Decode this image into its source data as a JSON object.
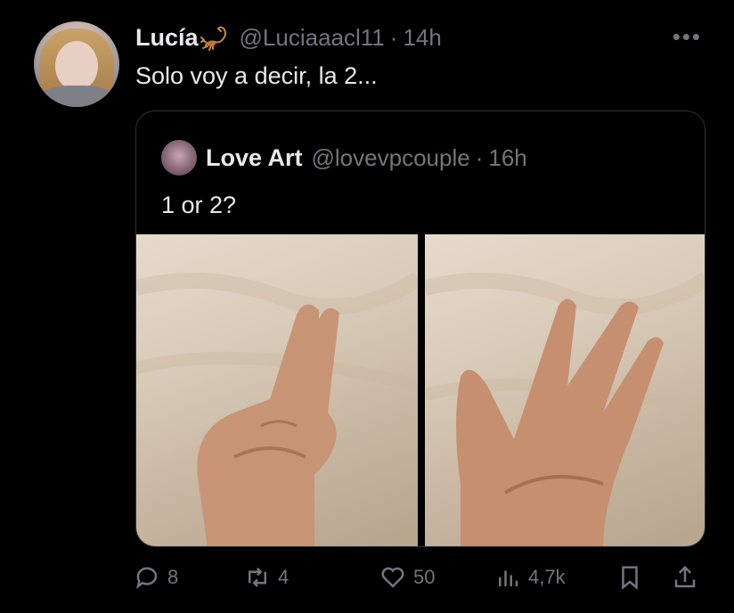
{
  "tweet": {
    "author_name": "Lucía",
    "handle": "@Luciaaacl11",
    "time": "14h",
    "text": "Solo voy a decir, la 2...",
    "more_icon": "more-dots-icon"
  },
  "quoted": {
    "author_name": "Love Art",
    "handle": "@lovevpcouple",
    "time": "16h",
    "text": "1 or 2?"
  },
  "actions": {
    "replies": "8",
    "retweets": "4",
    "likes": "50",
    "views": "4,7k",
    "icons": [
      "reply-icon",
      "retweet-icon",
      "like-icon",
      "views-icon",
      "bookmark-icon",
      "share-icon"
    ]
  },
  "colors": {
    "background": "#000000",
    "text_primary": "#e7e9ea",
    "text_secondary": "#71767b",
    "border": "#2f3336"
  }
}
